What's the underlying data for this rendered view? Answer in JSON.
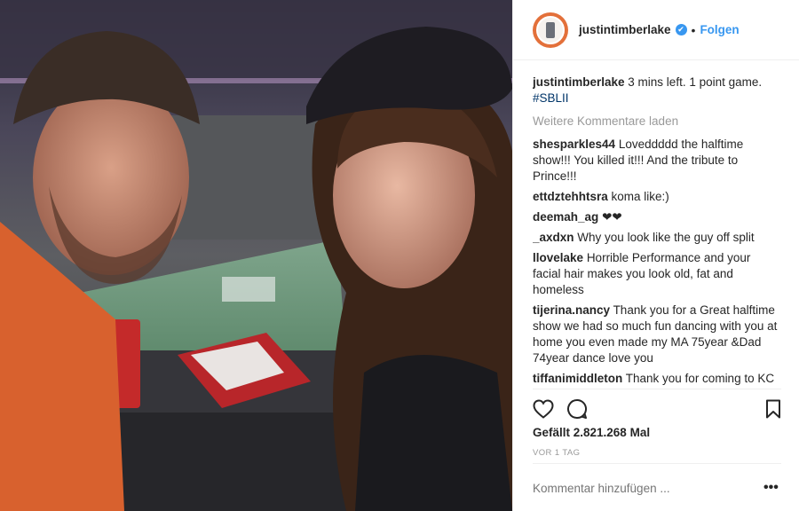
{
  "header": {
    "username": "justintimberlake",
    "verified_mark": "✔",
    "separator": "•",
    "follow_label": "Folgen"
  },
  "caption": {
    "user": "justintimberlake",
    "text": "3 mins left. 1 point game.",
    "hashtag": "#SBLII"
  },
  "load_more_label": "Weitere Kommentare laden",
  "comments": [
    {
      "user": "shesparkles44",
      "text": "Loveddddd the halftime show!!! You killed it!!! And the tribute to Prince!!!"
    },
    {
      "user": "ettdztehhtsra",
      "text": "koma like:)"
    },
    {
      "user": "deemah_ag",
      "text": "❤❤"
    },
    {
      "user": "_axdxn",
      "text": "Why you look like the guy off split"
    },
    {
      "user": "llovelake",
      "text": "Horrible Performance and your facial hair makes you look old, fat and homeless"
    },
    {
      "user": "tijerina.nancy",
      "text": "Thank you for a Great halftime show we had so much fun dancing with you at home you even made my MA 75year &Dad 74year dance love you"
    },
    {
      "user": "tiffanimiddleton",
      "text": "Thank you for coming to KC in December!!"
    }
  ],
  "likes_text": "Gefällt 2.821.268 Mal",
  "timestamp": "VOR 1 TAG",
  "add_comment_placeholder": "Kommentar hinzufügen ...",
  "more_options_glyph": "•••",
  "icons": {
    "like": "heart-icon",
    "comment": "comment-bubble-icon",
    "save": "bookmark-icon",
    "more": "more-options-icon"
  },
  "colors": {
    "link": "#3897f0",
    "hashtag": "#003569",
    "muted": "#999999",
    "text": "#262626"
  }
}
